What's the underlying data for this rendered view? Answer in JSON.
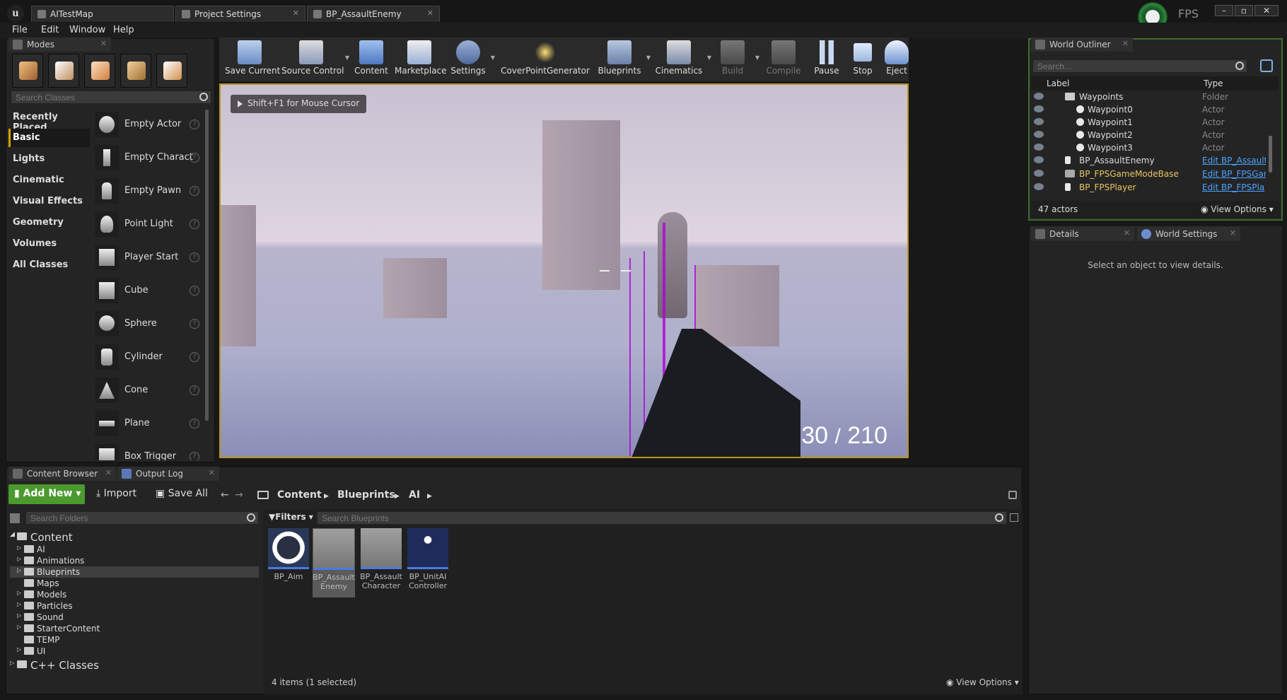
{
  "window": {
    "tabs": [
      {
        "label": "AITestMap"
      },
      {
        "label": "Project Settings"
      },
      {
        "label": "BP_AssaultEnemy"
      }
    ],
    "fps_label": "FPS",
    "min": "–",
    "max": "▫",
    "close": "✕"
  },
  "menu": [
    "File",
    "Edit",
    "Window",
    "Help"
  ],
  "modes": {
    "tab": "Modes",
    "search_placeholder": "Search Classes",
    "categories": [
      "Recently Placed",
      "Basic",
      "Lights",
      "Cinematic",
      "Visual Effects",
      "Geometry",
      "Volumes",
      "All Classes"
    ],
    "items": [
      "Empty Actor",
      "Empty Charact",
      "Empty Pawn",
      "Point Light",
      "Player Start",
      "Cube",
      "Sphere",
      "Cylinder",
      "Cone",
      "Plane",
      "Box Trigger"
    ]
  },
  "toolbar": [
    {
      "label": "Save Current",
      "icon": "save-icon"
    },
    {
      "label": "Source Control",
      "icon": "source-control-icon"
    },
    {
      "label": "Content",
      "icon": "content-icon"
    },
    {
      "label": "Marketplace",
      "icon": "marketplace-icon"
    },
    {
      "label": "Settings",
      "icon": "settings-icon"
    },
    {
      "label": "CoverPointGenerator",
      "icon": "cover-point-icon"
    },
    {
      "label": "Blueprints",
      "icon": "blueprints-icon"
    },
    {
      "label": "Cinematics",
      "icon": "cinematics-icon"
    },
    {
      "label": "Build",
      "icon": "build-icon"
    },
    {
      "label": "Compile",
      "icon": "compile-icon"
    },
    {
      "label": "Pause",
      "icon": "pause-icon"
    },
    {
      "label": "Stop",
      "icon": "stop-icon"
    },
    {
      "label": "Eject",
      "icon": "eject-icon"
    }
  ],
  "viewport": {
    "hint": "Shift+F1 for Mouse Cursor",
    "ammo_current": "30",
    "ammo_sep": "/",
    "ammo_total": "210"
  },
  "outliner": {
    "tab": "World Outliner",
    "search_placeholder": "Search...",
    "col_label": "Label",
    "col_type": "Type",
    "rows": [
      {
        "label": "Waypoints",
        "type": "Folder"
      },
      {
        "label": "Waypoint0",
        "type": "Actor"
      },
      {
        "label": "Waypoint1",
        "type": "Actor"
      },
      {
        "label": "Waypoint2",
        "type": "Actor"
      },
      {
        "label": "Waypoint3",
        "type": "Actor"
      },
      {
        "label": "BP_AssaultEnemy",
        "type": "Edit BP_Assault"
      },
      {
        "label": "BP_FPSGameModeBase",
        "type": "Edit BP_FPSGan"
      },
      {
        "label": "BP_FPSPlayer",
        "type": "Edit BP_FPSPla"
      }
    ],
    "count": "47 actors",
    "view_options": "View Options"
  },
  "details": {
    "tab": "Details",
    "tab2": "World Settings",
    "empty": "Select an object to view details."
  },
  "content_browser": {
    "tab": "Content Browser",
    "tab2": "Output Log",
    "add_new": "Add New",
    "import": "Import",
    "save_all": "Save All",
    "breadcrumb": [
      "Content",
      "Blueprints",
      "AI"
    ],
    "folder_search": "Search Folders",
    "filters": "Filters",
    "bp_search": "Search Blueprints",
    "tree_root": "Content",
    "folders": [
      "AI",
      "Animations",
      "Blueprints",
      "Maps",
      "Models",
      "Particles",
      "Sound",
      "StarterContent",
      "TEMP",
      "UI"
    ],
    "cpp": "C++ Classes",
    "assets": [
      {
        "line1": "BP_Aim",
        "line2": ""
      },
      {
        "line1": "BP_Assault",
        "line2": "Enemy"
      },
      {
        "line1": "BP_Assault",
        "line2": "Character"
      },
      {
        "line1": "BP_UnitAI",
        "line2": "Controller"
      }
    ],
    "status": "4 items (1 selected)",
    "view_options": "View Options"
  }
}
